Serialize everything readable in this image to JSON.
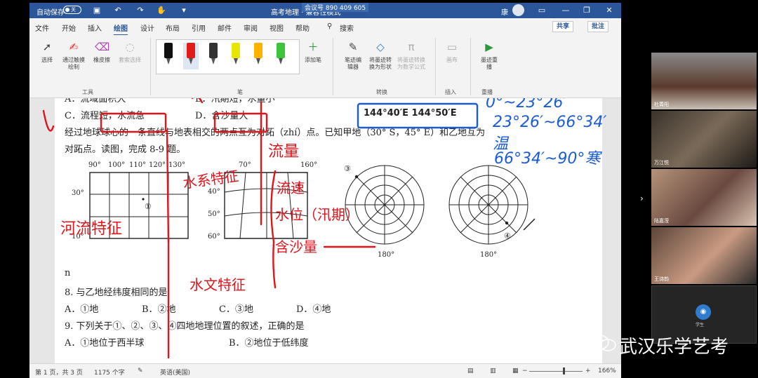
{
  "titlebar": {
    "autosave_label": "自动保存",
    "autosave_state": "关",
    "doc_title": "高考地理 · 兼容性模式",
    "meeting": "会议号 890 409 605",
    "user": "康"
  },
  "menu": {
    "tabs": [
      "文件",
      "开始",
      "插入",
      "绘图",
      "设计",
      "布局",
      "引用",
      "邮件",
      "审阅",
      "视图",
      "帮助"
    ],
    "active_tab": "绘图",
    "search_label": "搜索",
    "share_label": "共享",
    "comment_label": "批注"
  },
  "ribbon": {
    "select": "选择",
    "draw_touch": "通过触摸绘制",
    "eraser": "橡皮擦",
    "lasso": "套索选择",
    "tools_group": "工具",
    "pen_group": "笔",
    "add_pen": "添加笔",
    "ink_editor": "笔迹编辑器",
    "ink_to_shape": "将墨迹转换为形状",
    "ink_to_math": "将墨迹转换为数学公式",
    "convert_group": "转换",
    "canvas": "画布",
    "insert_group": "插入",
    "ink_replay": "墨迹重播",
    "replay_group": "重播",
    "pen_colors": [
      "#111111",
      "#e21b1b",
      "#333333",
      "#e6e600",
      "#ffb000",
      "#3cc43c"
    ]
  },
  "document": {
    "q7_options_top": [
      "A．流域面积大",
      "B．汛期短，水量小"
    ],
    "q7_options": [
      "C．流程短，水流急",
      "D．含沙量大"
    ],
    "intro_line1": "经过地球球心的一条直线与地表相交的两点互为对跖（zhí）点。已知甲地（30° S，45° E）和乙地互为",
    "intro_line2": "对跖点。读图，完成 8-9 题。",
    "map1_top_labels": [
      "90°",
      "100°",
      "110°",
      "120°",
      "130°"
    ],
    "map1_side_labels": [
      "30°",
      "10°"
    ],
    "map1_marker": "①",
    "map2_top_labels": [
      "70°",
      "160°"
    ],
    "map2_side_labels": [
      "40°",
      "50°",
      "60°"
    ],
    "polar1_marker": "③",
    "polar1_bottom": "180°",
    "polar2_marker": "④",
    "polar2_bottom": "180°",
    "fig_ref": "n",
    "q8": "8. 与乙地经纬度相同的是",
    "q8_options": [
      "A．①地",
      "B．②地",
      "C．③地",
      "D．④地"
    ],
    "q9": "9. 下列关于①、②、③、④四地地理位置的叙述，正确的是",
    "q9_options": [
      "A．①地位于西半球",
      "B．②地位于低纬度"
    ]
  },
  "annotations": {
    "coords_box": "144°40′E 144°50′E",
    "note_flow": "流量",
    "note_velocity": "流速",
    "note_level": "水位（汛期）",
    "note_sediment": "含沙量",
    "note_water_system": "水系特征",
    "note_hydro": "水文特征",
    "note_river": "河流特征",
    "blue_line1": "0°~23°26′",
    "blue_line2": "23°26′~66°34′温",
    "blue_line3": "66°34′~90°寒"
  },
  "statusbar": {
    "page": "第 1 页，共 3 页",
    "words": "1175 个字",
    "language": "英语(美国)",
    "zoom": "166%"
  },
  "participants": [
    "杜菁阳",
    "万江悦",
    "陆嘉滢",
    "王诗韵"
  ],
  "self_label": "学生",
  "watermark": "武汉乐学艺考"
}
